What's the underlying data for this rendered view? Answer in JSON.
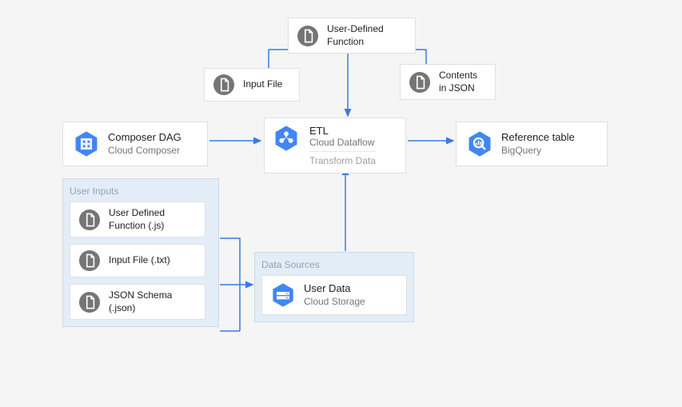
{
  "nodes": {
    "udf_top": {
      "title": "User-Defined Function"
    },
    "input_file": {
      "title": "Input File"
    },
    "contents_json": {
      "line1": "Contents",
      "line2": "in JSON"
    },
    "composer": {
      "title": "Composer DAG",
      "subtitle": "Cloud Composer"
    },
    "etl": {
      "title": "ETL",
      "subtitle": "Cloud Dataflow",
      "transform": "Transform Data"
    },
    "reference": {
      "title": "Reference table",
      "subtitle": "BigQuery"
    },
    "user_data": {
      "title": "User Data",
      "subtitle": "Cloud Storage"
    }
  },
  "groups": {
    "user_inputs": {
      "title": "User Inputs",
      "items": [
        {
          "line1": "User Defined",
          "line2": "Function (.js)"
        },
        {
          "line1": "Input File (.txt)"
        },
        {
          "line1": "JSON Schema",
          "line2": "(.json)"
        }
      ]
    },
    "data_sources": {
      "title": "Data Sources"
    }
  },
  "colors": {
    "icon_gray": "#757575",
    "icon_blue": "#4285f4",
    "arrow": "#3b78e7"
  }
}
